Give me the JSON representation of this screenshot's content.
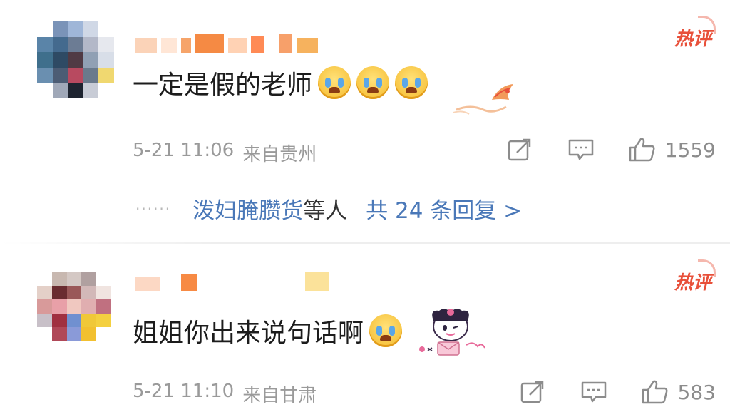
{
  "comments": [
    {
      "text": "一定是假的老师",
      "hot_label": "热评",
      "date": "5-21 11:06",
      "location": "来自贵州",
      "likes": "1559",
      "replies": {
        "names": "泼妇腌臜货",
        "suffix": "等人",
        "count_text": "共 24 条回复 >"
      }
    },
    {
      "text": "姐姐你出来说句话啊",
      "hot_label": "热评",
      "date": "5-21 11:10",
      "location": "来自甘肃",
      "likes": "583"
    }
  ],
  "icons": {
    "share": "share-icon",
    "comment": "comment-icon",
    "like": "thumbs-up-icon",
    "emoji": "crying-face-icon"
  },
  "colors": {
    "hot": "#e8503a",
    "link": "#4a78b8",
    "meta": "#9a9a9a"
  }
}
